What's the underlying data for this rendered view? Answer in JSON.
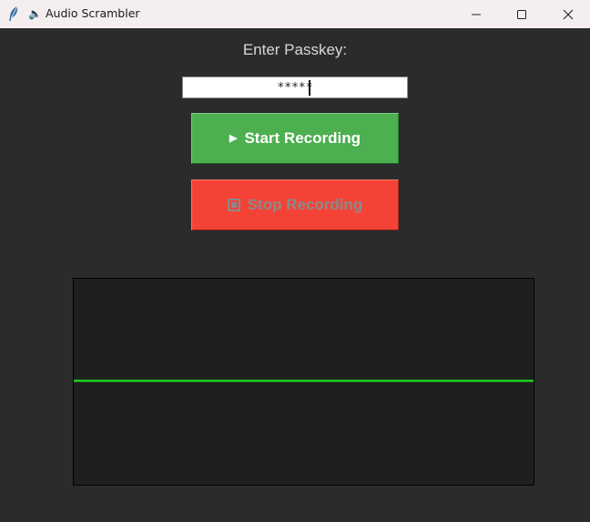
{
  "window": {
    "title": "Audio Scrambler",
    "title_icon": "speaker-icon",
    "app_icon": "feather-icon",
    "controls": [
      "minimize",
      "maximize",
      "close"
    ]
  },
  "passkey": {
    "label": "Enter Passkey:",
    "value": "*****"
  },
  "buttons": {
    "start": {
      "label": "Start Recording",
      "icon": "play-icon",
      "color": "#4caf50",
      "enabled": true
    },
    "stop": {
      "label": "Stop Recording",
      "icon": "stop-icon",
      "color": "#f44336",
      "enabled": false
    }
  },
  "waveform": {
    "background": "#1f1f1f",
    "line_color": "#22cc22",
    "level": 0
  }
}
